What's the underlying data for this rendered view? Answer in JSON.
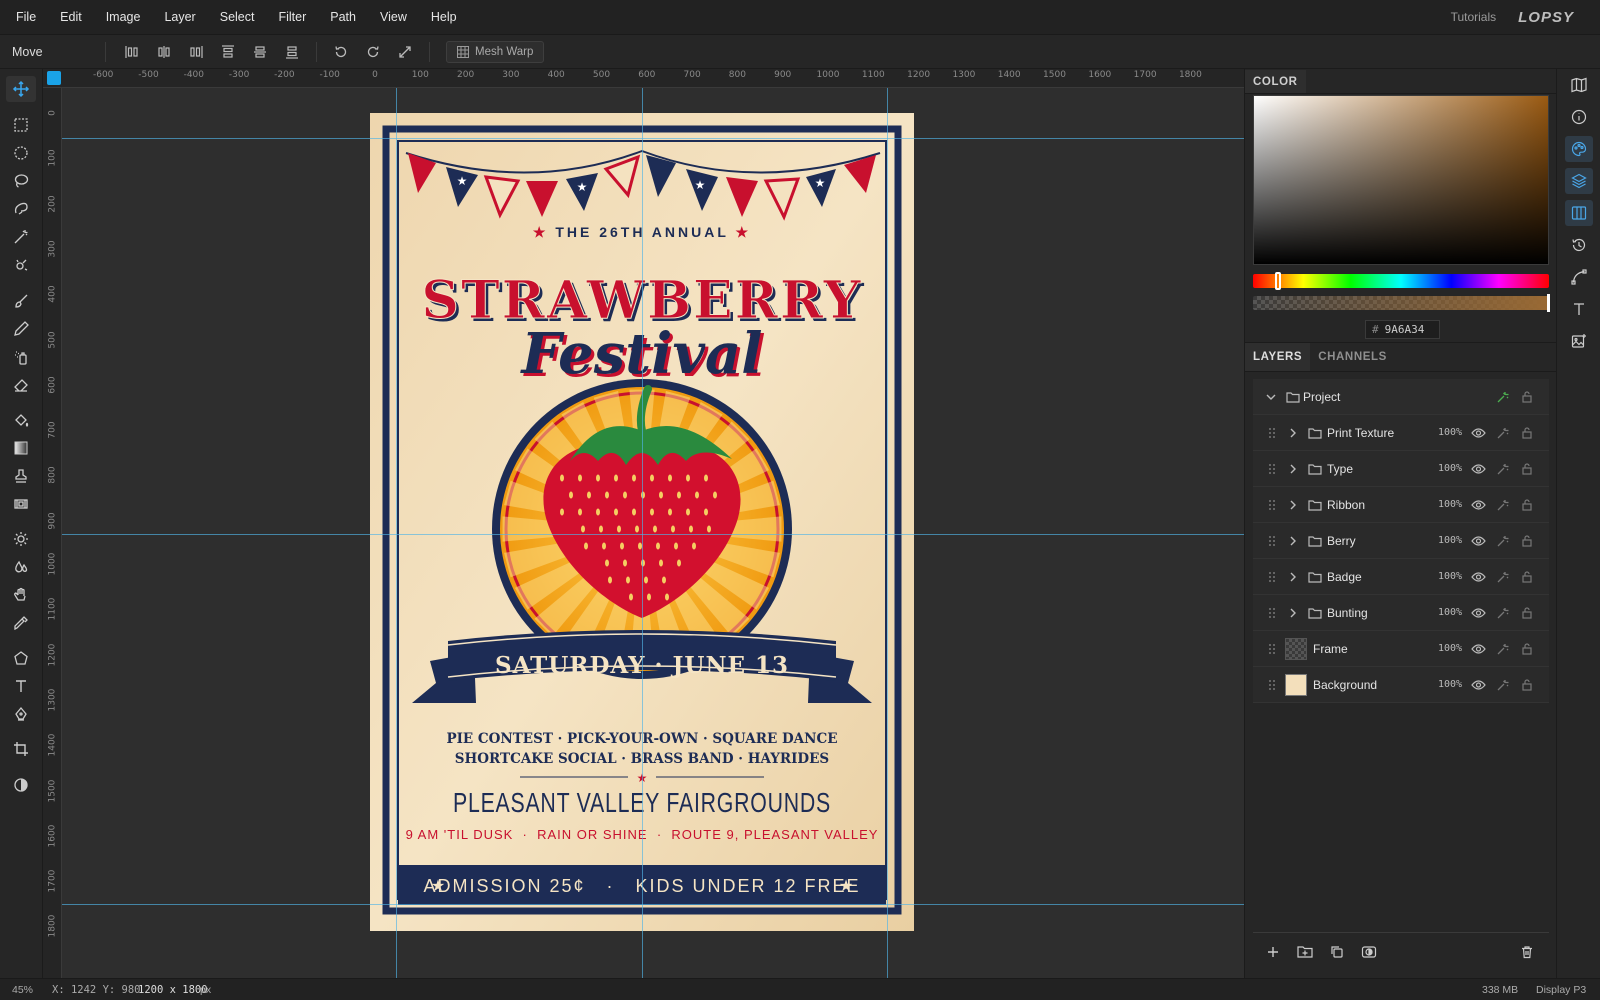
{
  "menu": {
    "items": [
      "File",
      "Edit",
      "Image",
      "Layer",
      "Select",
      "Filter",
      "Path",
      "View",
      "Help"
    ],
    "tutorials": "Tutorials",
    "logo": "LOPSY"
  },
  "options_bar": {
    "tool_name": "Move",
    "mesh_warp_label": "Mesh Warp"
  },
  "ruler": {
    "top_labels": [
      "-600",
      "-500",
      "-400",
      "-300",
      "-200",
      "-100",
      "0",
      "100",
      "200",
      "300",
      "400",
      "500",
      "600",
      "700",
      "800",
      "900",
      "1000",
      "1100",
      "1200",
      "1300",
      "1400",
      "1500",
      "1600",
      "1700",
      "1800"
    ],
    "left_labels": [
      "0",
      "100",
      "200",
      "300",
      "400",
      "500",
      "600",
      "700",
      "800",
      "900",
      "1000",
      "1100",
      "1200",
      "1300",
      "1400",
      "1500",
      "1600",
      "1700",
      "1800"
    ]
  },
  "poster": {
    "annual": "THE 26TH ANNUAL",
    "title1": "STRAWBERRY",
    "title2": "Festival",
    "date": "SATURDAY · JUNE 13",
    "events1": "PIE CONTEST · PICK-YOUR-OWN · SQUARE DANCE",
    "events2": "SHORTCAKE SOCIAL · BRASS BAND · HAYRIDES",
    "venue": "PLEASANT VALLEY FAIRGROUNDS",
    "details": "9 AM 'TIL DUSK  ·  RAIN OR SHINE  ·  ROUTE 9, PLEASANT VALLEY",
    "admission": "ADMISSION 25¢   ·   KIDS UNDER 12 FREE",
    "colors": {
      "cream": "#f3e2c0",
      "navy": "#1d2c55",
      "red": "#c8102e",
      "orange": "#f3a51c"
    }
  },
  "color_panel": {
    "title": "COLOR",
    "hex_value": "9A6A34",
    "hex_prefix": "#"
  },
  "layers_panel": {
    "tab_layers": "LAYERS",
    "tab_channels": "CHANNELS",
    "root": {
      "name": "Project"
    },
    "layers": [
      {
        "name": "Print Texture",
        "opacity": "100%",
        "type": "group"
      },
      {
        "name": "Type",
        "opacity": "100%",
        "type": "group"
      },
      {
        "name": "Ribbon",
        "opacity": "100%",
        "type": "group"
      },
      {
        "name": "Berry",
        "opacity": "100%",
        "type": "group"
      },
      {
        "name": "Badge",
        "opacity": "100%",
        "type": "group"
      },
      {
        "name": "Bunting",
        "opacity": "100%",
        "type": "group"
      },
      {
        "name": "Frame",
        "opacity": "100%",
        "type": "layer"
      },
      {
        "name": "Background",
        "opacity": "100%",
        "type": "layer"
      }
    ]
  },
  "status": {
    "zoom": "45%",
    "coords": "X: 1242 Y: 980",
    "dimensions": "1200 x 1800",
    "dim_unit": "px",
    "memory": "338 MB",
    "color_profile": "Display P3"
  }
}
